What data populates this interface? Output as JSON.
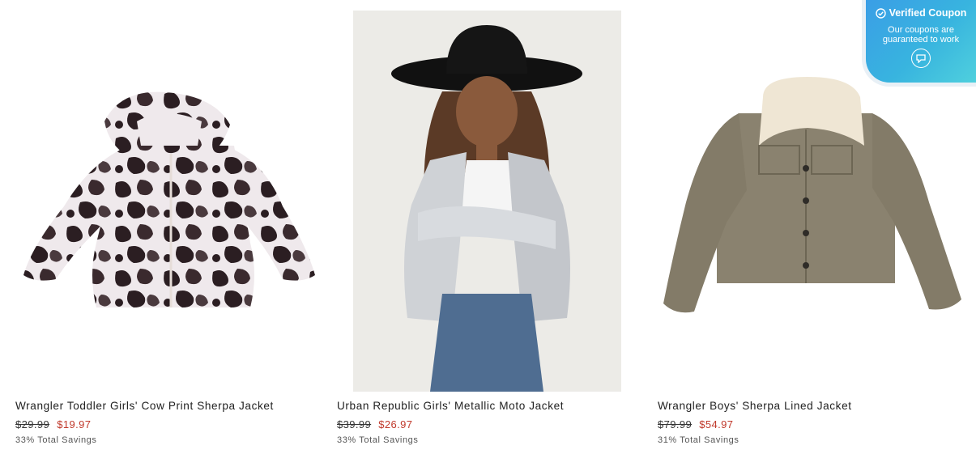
{
  "products": [
    {
      "title": "Wrangler Toddler Girls' Cow Print Sherpa Jacket",
      "original_price": "$29.99",
      "sale_price": "$19.97",
      "savings": "33% Total Savings"
    },
    {
      "title": "Urban Republic Girls' Metallic Moto Jacket",
      "original_price": "$39.99",
      "sale_price": "$26.97",
      "savings": "33% Total Savings"
    },
    {
      "title": "Wrangler Boys' Sherpa Lined Jacket",
      "original_price": "$79.99",
      "sale_price": "$54.97",
      "savings": "31% Total Savings"
    }
  ],
  "coupon": {
    "title": "Verified Coupon",
    "subtitle": "Our coupons are guaranteed to work",
    "icon": "coupon-chat-icon"
  },
  "colors": {
    "sale_price": "#c0392b",
    "coupon_gradient_start": "#3a9ee6",
    "coupon_gradient_end": "#4fd0dd"
  }
}
